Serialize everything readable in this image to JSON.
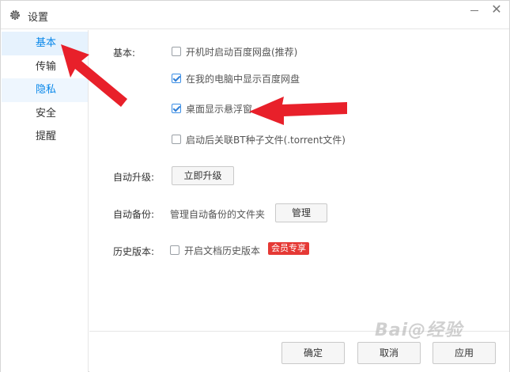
{
  "window": {
    "title": "设置",
    "settings_icon": "gear-icon",
    "minimize_icon": "minimize-icon",
    "close_icon": "close-icon",
    "close_glyph": "✕"
  },
  "sidebar": {
    "items": [
      {
        "label": "基本",
        "state": "active"
      },
      {
        "label": "传输",
        "state": "normal"
      },
      {
        "label": "隐私",
        "state": "hover"
      },
      {
        "label": "安全",
        "state": "normal"
      },
      {
        "label": "提醒",
        "state": "normal"
      }
    ]
  },
  "basic": {
    "label": "基本:",
    "options": [
      {
        "text": "开机时启动百度网盘(推荐)",
        "checked": false
      },
      {
        "text": "在我的电脑中显示百度网盘",
        "checked": true
      },
      {
        "text": "桌面显示悬浮窗",
        "checked": true
      },
      {
        "text": "启动后关联BT种子文件(.torrent文件)",
        "checked": false
      }
    ]
  },
  "auto_upgrade": {
    "label": "自动升级:",
    "button": "立即升级"
  },
  "auto_backup": {
    "label": "自动备份:",
    "desc": "管理自动备份的文件夹",
    "button": "管理"
  },
  "history": {
    "label": "历史版本:",
    "option": "开启文档历史版本",
    "checked": false,
    "badge": "会员专享"
  },
  "footer": {
    "ok": "确定",
    "cancel": "取消",
    "apply": "应用"
  },
  "watermark": "Bai@经验",
  "colors": {
    "accent": "#0a88ea",
    "active_bg": "#e6f2fd",
    "badge": "#e53935",
    "arrow": "#e8202a"
  }
}
